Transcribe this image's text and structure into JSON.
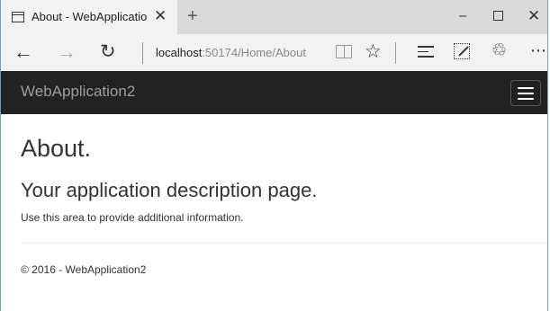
{
  "browser": {
    "tab": {
      "title": "About - WebApplicatior",
      "close": "✕"
    },
    "new_tab": "+",
    "window": {
      "minimize": "–",
      "close": "✕"
    },
    "nav": {
      "back": "←",
      "forward": "→",
      "refresh": "↻"
    },
    "address": {
      "host": "localhost",
      "path": ":50174/Home/About"
    },
    "favorites_glyph": "☆",
    "share_glyph": "♲",
    "more_glyph": "⋯"
  },
  "site": {
    "brand": "WebApplication2"
  },
  "page": {
    "title": "About.",
    "subtitle": "Your application description page.",
    "body": "Use this area to provide additional information.",
    "footer": "© 2016 - WebApplication2"
  }
}
